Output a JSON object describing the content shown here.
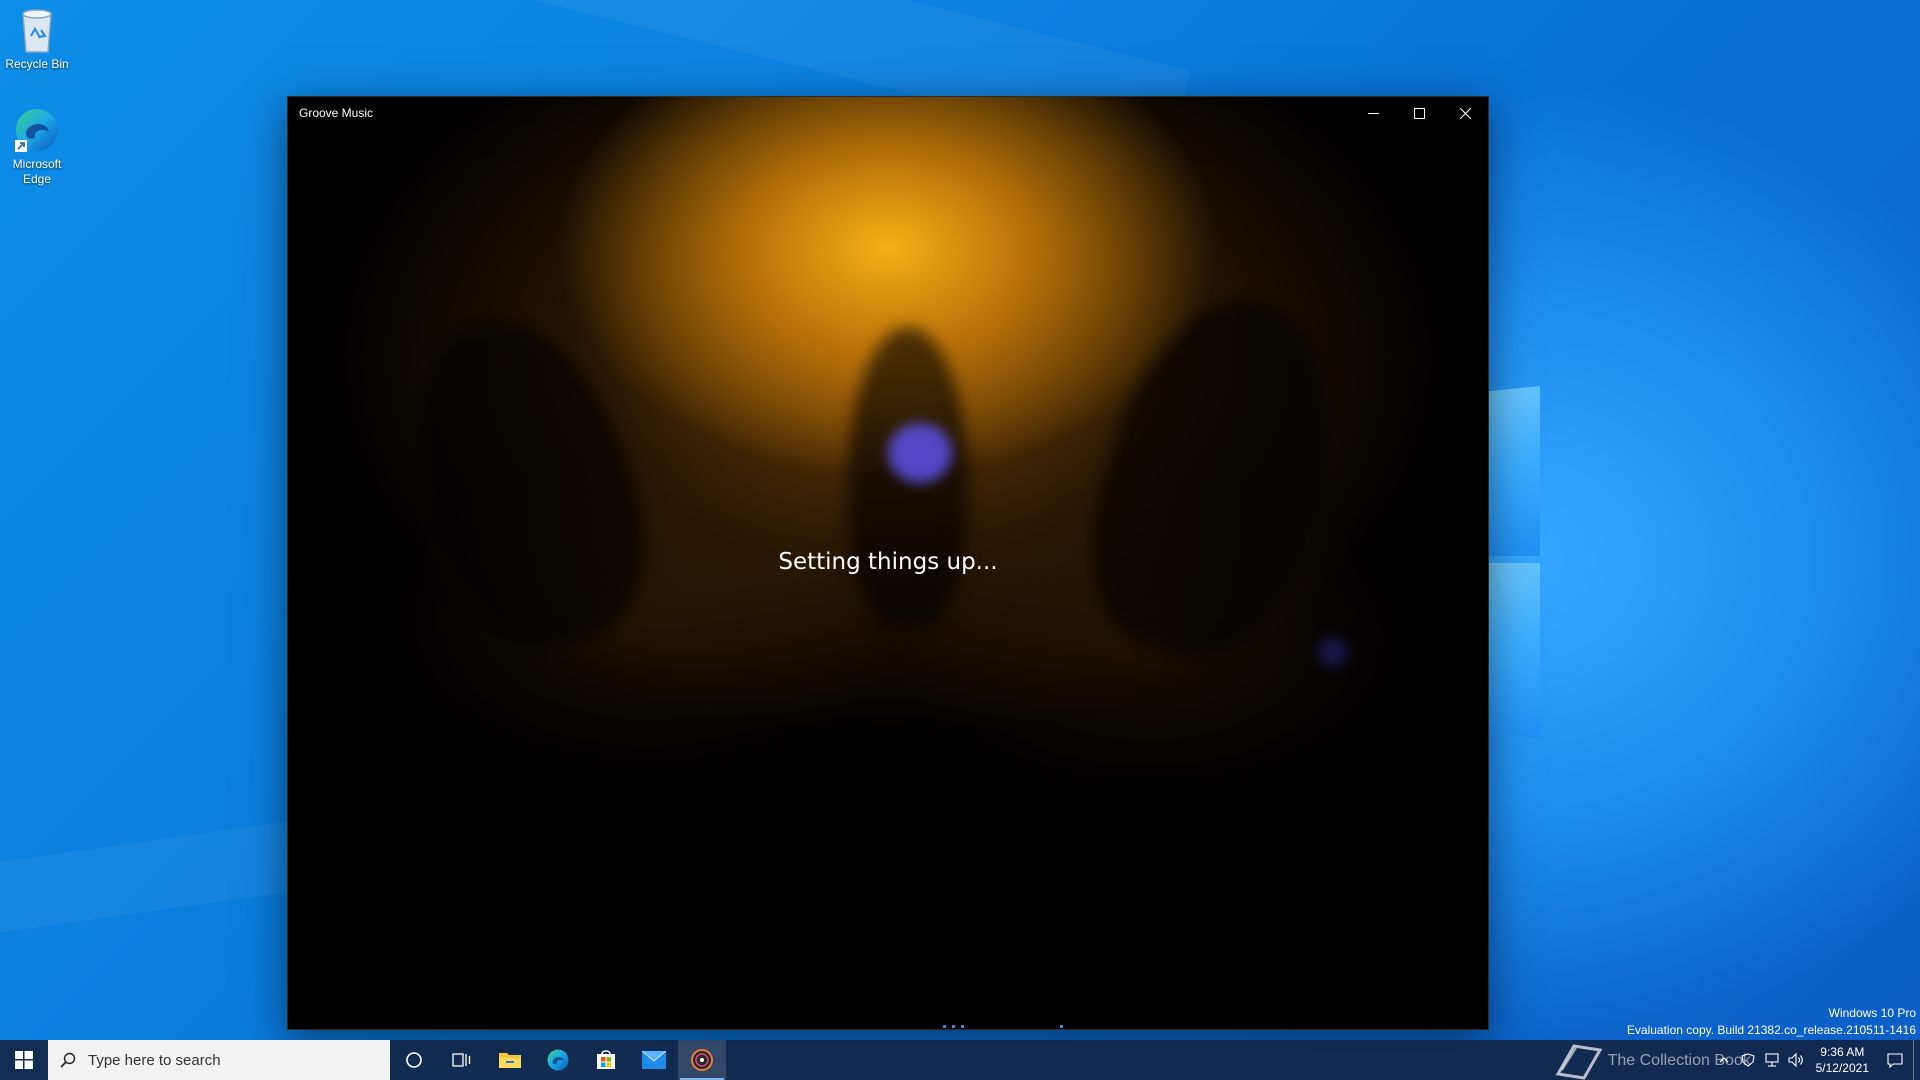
{
  "desktop": {
    "icons": [
      {
        "label": "Recycle Bin",
        "icon": "recycle-bin-icon"
      },
      {
        "label": "Microsoft Edge",
        "icon": "edge-icon"
      }
    ],
    "watermark": {
      "line1": "Windows 10 Pro",
      "line2": "Evaluation copy. Build 21382.co_release.210511-1416",
      "site": "The Collection Book"
    }
  },
  "window": {
    "title": "Groove Music",
    "status_text": "Setting things up...",
    "minimize_icon": "minimize-icon",
    "maximize_icon": "maximize-icon",
    "close_icon": "close-icon"
  },
  "taskbar": {
    "search_placeholder": "Type here to search",
    "pinned": [
      "cortana-icon",
      "task-view-icon",
      "file-explorer-icon",
      "edge-icon",
      "store-icon",
      "mail-icon",
      "groove-music-icon"
    ],
    "active_app": "groove-music-icon",
    "tray": {
      "time": "9:36 AM",
      "date": "5/12/2021",
      "icons": [
        "chevron-up-icon",
        "security-icon",
        "network-icon",
        "volume-icon",
        "notification-icon"
      ]
    }
  },
  "colors": {
    "desktop_blue": "#0a7fe0",
    "taskbar": "#12264a",
    "accent": "#7fb8ee",
    "splash_glow": "#ffb814"
  }
}
